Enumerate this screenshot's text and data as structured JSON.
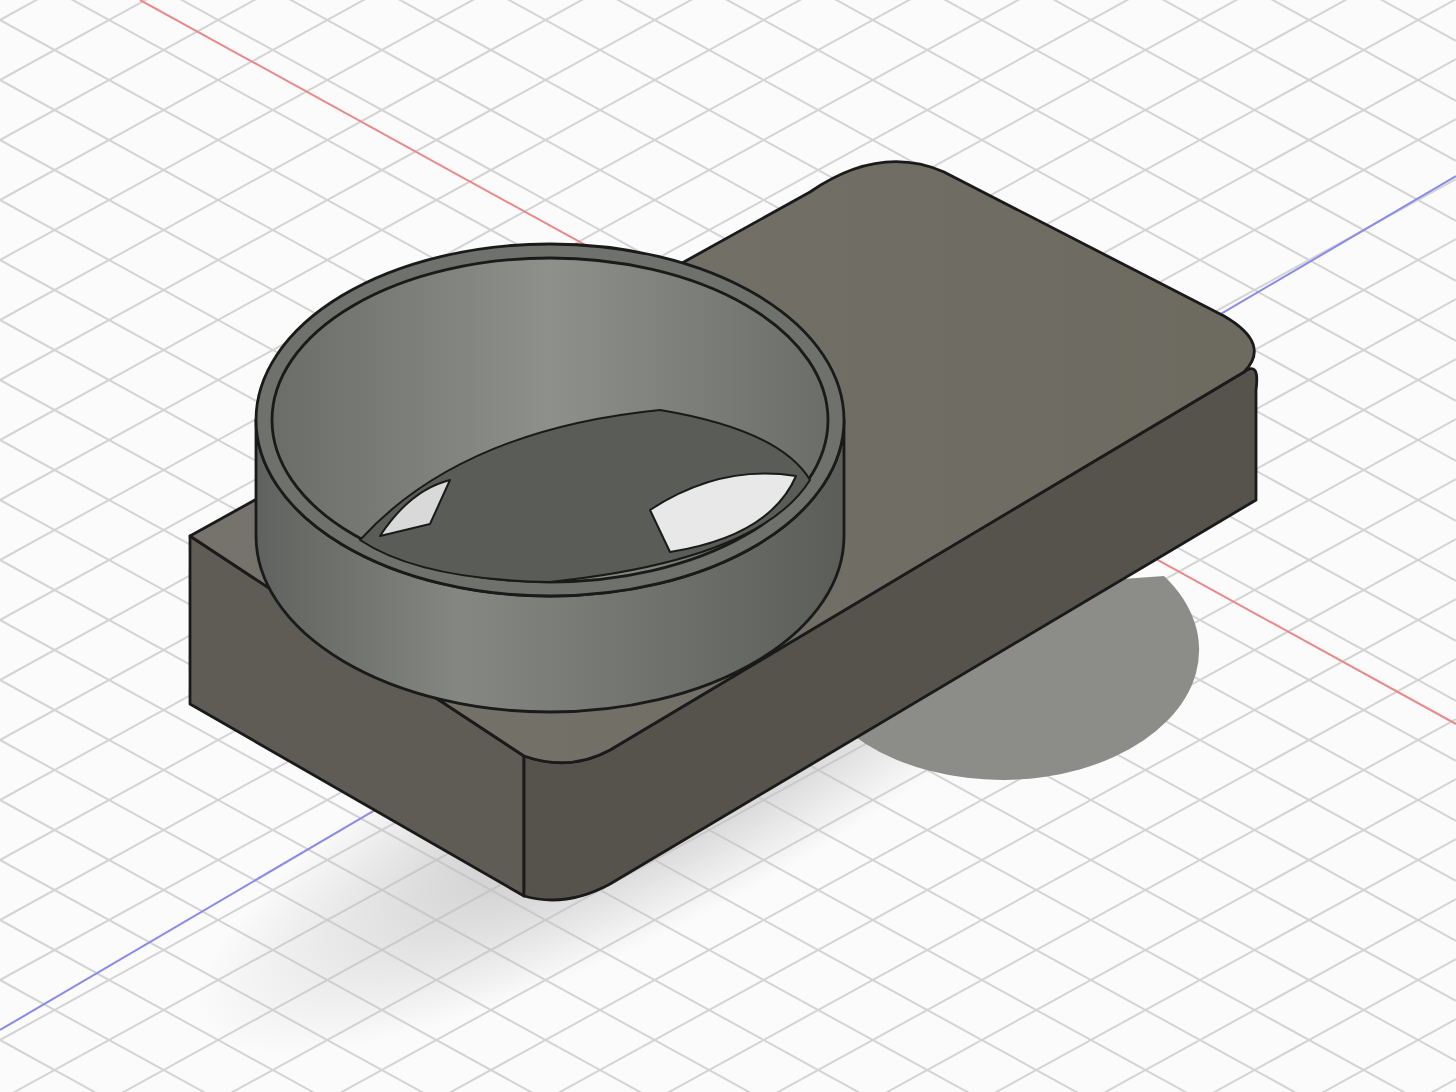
{
  "viewport": {
    "grid": true,
    "axes": true,
    "shadow": true
  }
}
